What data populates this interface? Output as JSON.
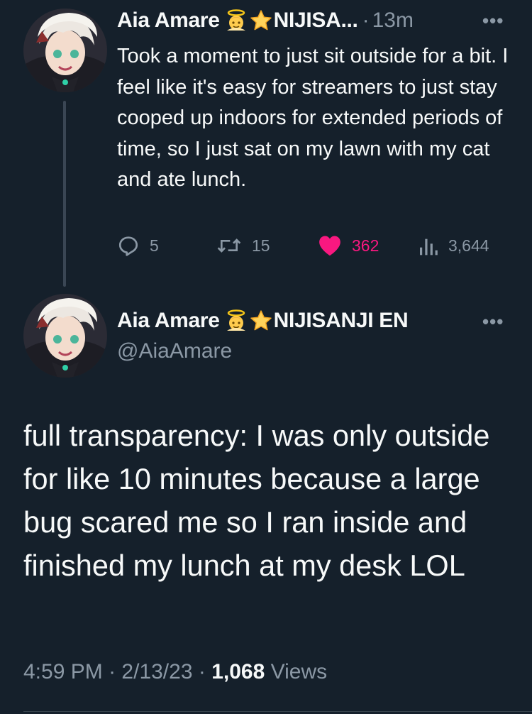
{
  "reply_tweet": {
    "display_name": "Aia Amare",
    "affiliation_truncated": "NIJISA...",
    "separator": "·",
    "time_ago": "13m",
    "more_label": "•••",
    "text": "Took a moment to just sit outside for a bit. I feel like it's easy for streamers to just stay cooped up indoors for extended periods of time, so I just sat on my lawn with my cat and ate lunch.",
    "replies": "5",
    "retweets": "15",
    "likes": "362",
    "views": "3,644",
    "liked": true,
    "icons": [
      "reply-icon",
      "retweet-icon",
      "heart-icon",
      "views-icon"
    ]
  },
  "main_tweet": {
    "display_name": "Aia Amare",
    "affiliation": "NIJISANJI EN",
    "handle": "@AiaAmare",
    "more_label": "•••",
    "text": "full transparency: I was only outside for like 10 minutes because a large bug scared me so I ran inside and finished my lunch at my desk LOL",
    "time": "4:59 PM",
    "date": "2/13/23",
    "separator": "·",
    "views_count": "1,068",
    "views_label": "Views"
  },
  "colors": {
    "background": "#15202b",
    "text_primary": "#f7f9f9",
    "text_secondary": "#8b98a5",
    "like_pink": "#f91880"
  }
}
